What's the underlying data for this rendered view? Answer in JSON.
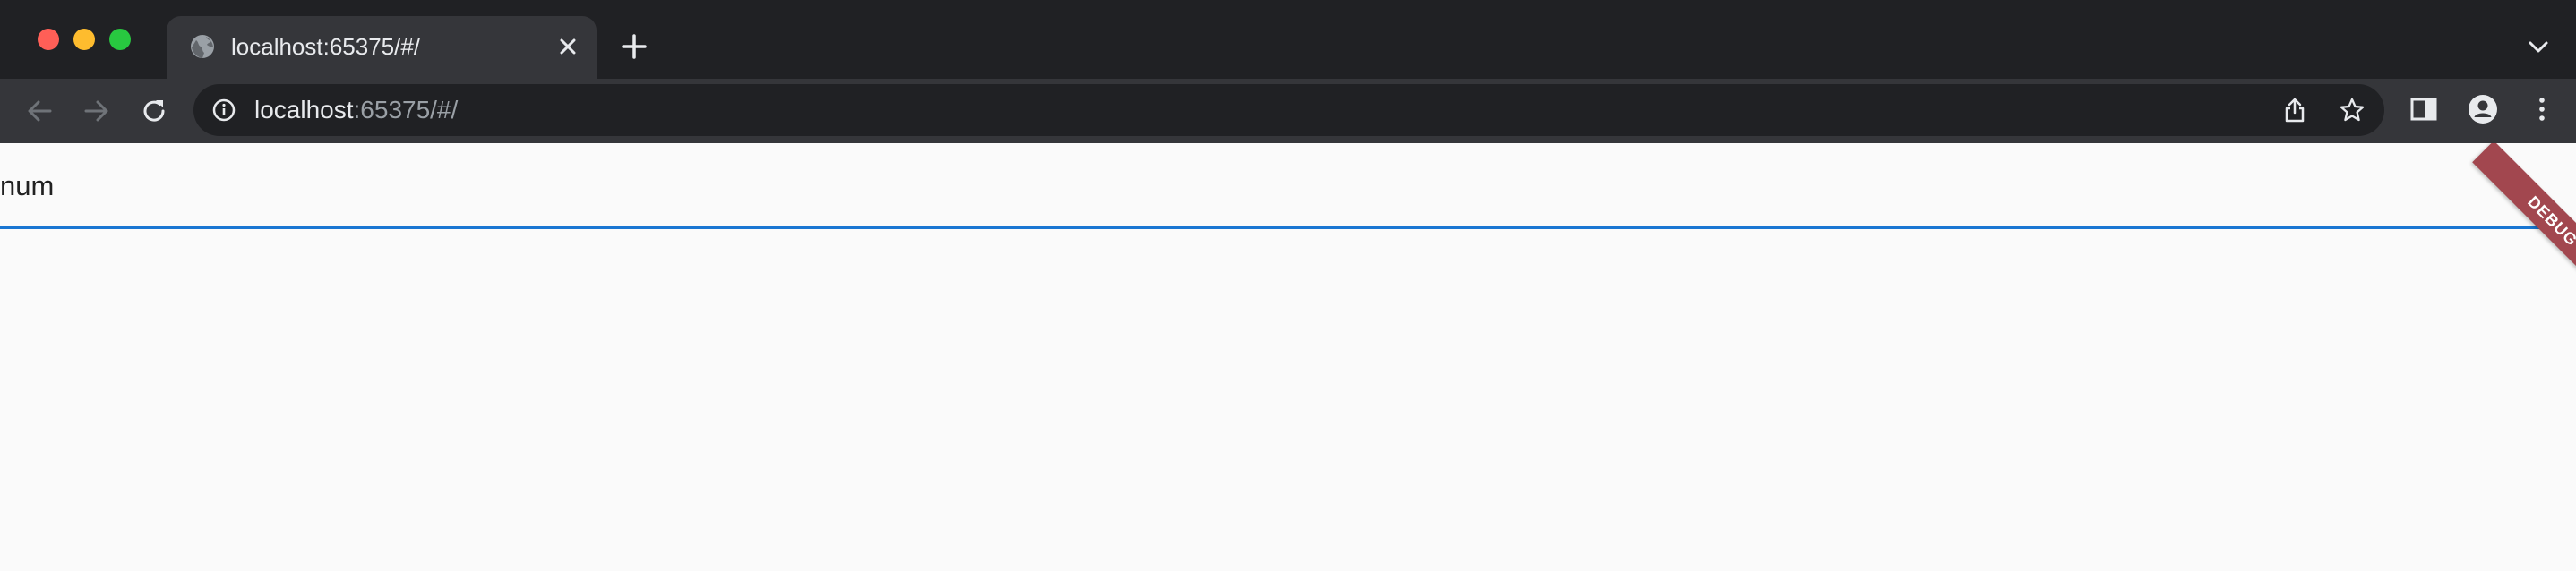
{
  "browser": {
    "tab": {
      "title": "localhost:65375/#/",
      "favicon": "globe-icon"
    },
    "address_bar": {
      "host": "localhost",
      "path": ":65375/#/"
    },
    "icons": {
      "back": "arrow-left-icon",
      "forward": "arrow-right-icon",
      "reload": "reload-icon",
      "info": "info-icon",
      "share": "share-icon",
      "bookmark": "star-icon",
      "side_panel": "side-panel-icon",
      "profile": "profile-icon",
      "menu": "kebab-menu-icon",
      "new_tab": "plus-icon",
      "tab_search": "chevron-down-icon"
    }
  },
  "app": {
    "text_field": {
      "value": "num"
    },
    "debug_banner": "DEBUG",
    "colors": {
      "focus_underline": "#1976d2",
      "debug_banner": "#a2474f",
      "background": "#fafafa"
    }
  }
}
